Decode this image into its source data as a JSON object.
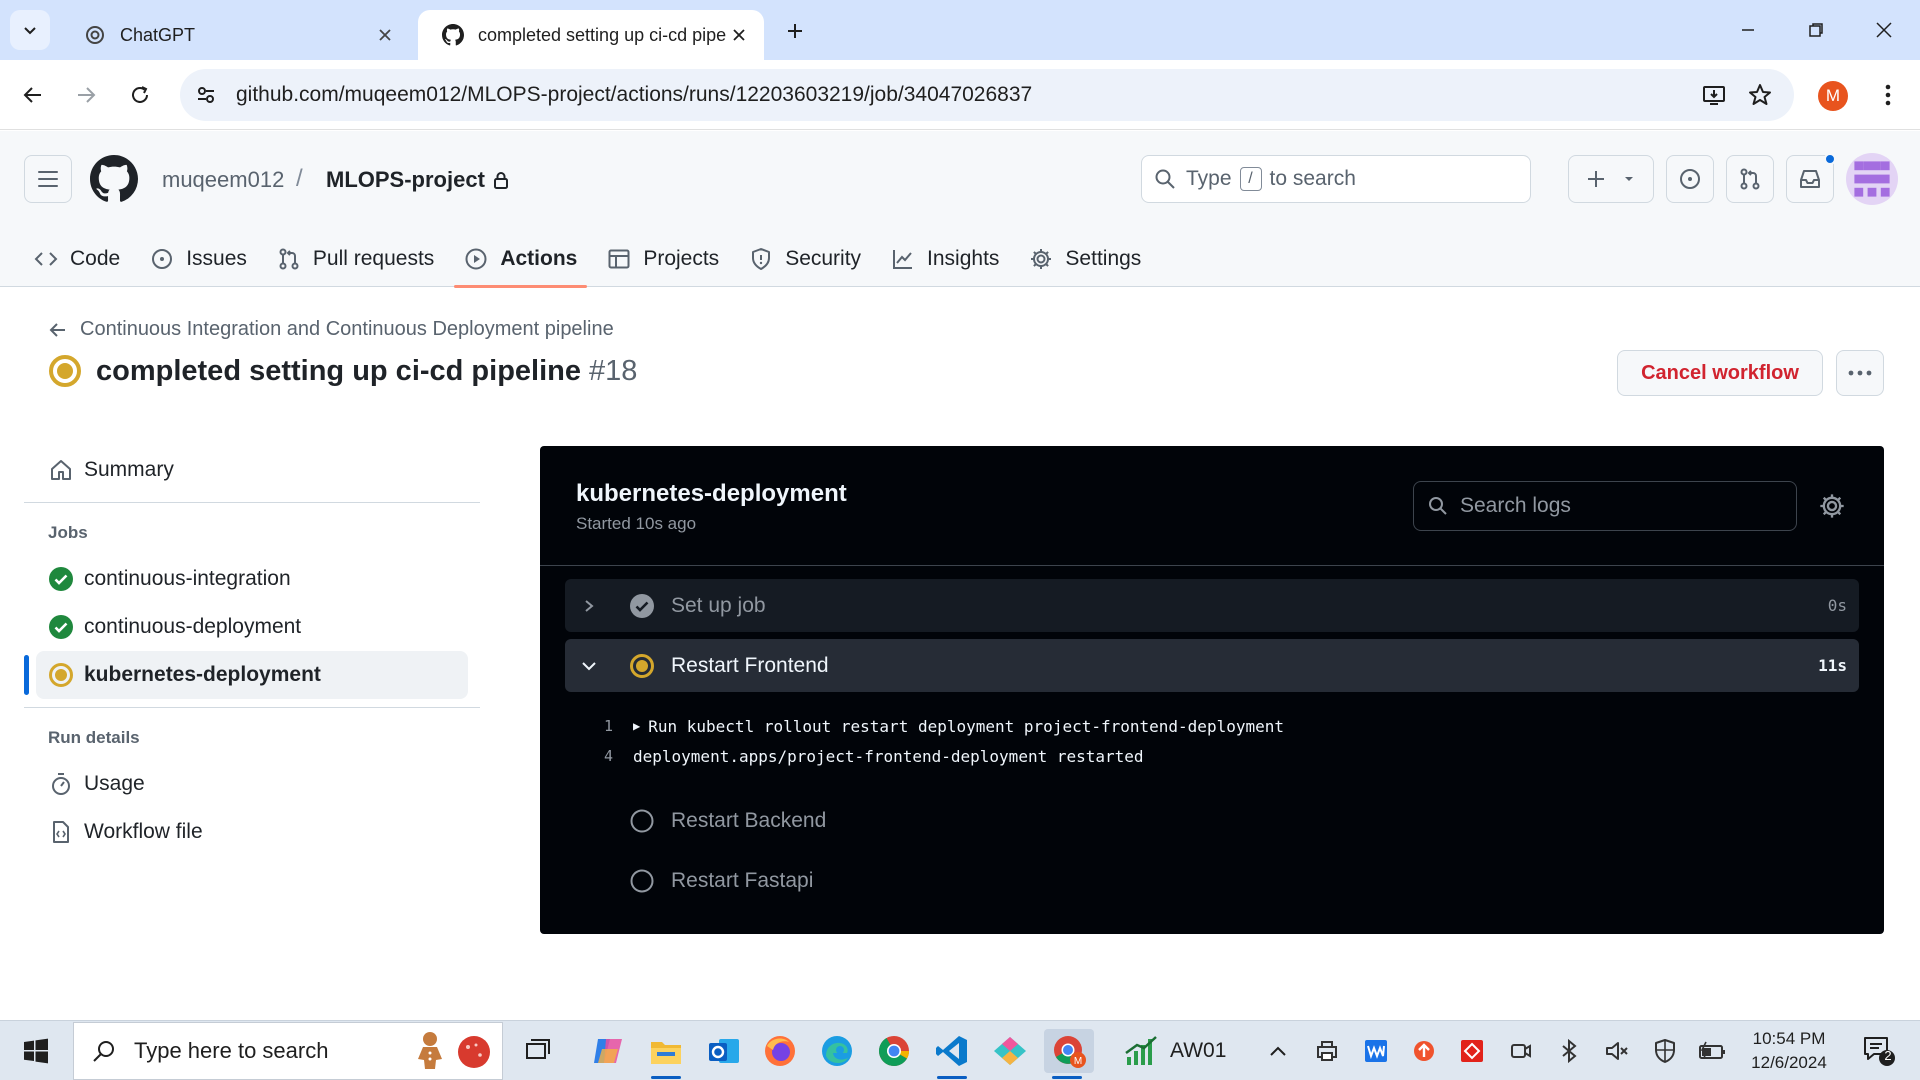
{
  "browser": {
    "tabs": [
      {
        "title": "ChatGPT",
        "icon": "chatgpt-icon",
        "active": false
      },
      {
        "title": "completed setting up ci-cd pipe",
        "icon": "github-icon",
        "active": true
      }
    ],
    "url": "github.com/muqeem012/MLOPS-project/actions/runs/12203603219/job/34047026837",
    "profile_initial": "M"
  },
  "github": {
    "owner": "muqeem012",
    "separator": "/",
    "repo": "MLOPS-project",
    "search": {
      "prefix": "Type",
      "key": "/",
      "suffix": "to search"
    },
    "repo_nav": [
      {
        "label": "Code",
        "icon": "code-icon"
      },
      {
        "label": "Issues",
        "icon": "issue-icon"
      },
      {
        "label": "Pull requests",
        "icon": "pull-request-icon"
      },
      {
        "label": "Actions",
        "icon": "play-icon",
        "active": true
      },
      {
        "label": "Projects",
        "icon": "table-icon"
      },
      {
        "label": "Security",
        "icon": "shield-icon"
      },
      {
        "label": "Insights",
        "icon": "graph-icon"
      },
      {
        "label": "Settings",
        "icon": "gear-icon"
      }
    ],
    "accent": "#fd8c73"
  },
  "run": {
    "workflow": "Continuous Integration and Continuous Deployment pipeline",
    "title": "completed setting up ci-cd pipeline",
    "number": "#18",
    "status": "in_progress",
    "cancel_label": "Cancel workflow"
  },
  "sidebar": {
    "summary": "Summary",
    "jobs_heading": "Jobs",
    "jobs": [
      {
        "name": "continuous-integration",
        "status": "success"
      },
      {
        "name": "continuous-deployment",
        "status": "success"
      },
      {
        "name": "kubernetes-deployment",
        "status": "in_progress",
        "selected": true
      }
    ],
    "details_heading": "Run details",
    "details": [
      {
        "label": "Usage",
        "icon": "stopwatch-icon"
      },
      {
        "label": "Workflow file",
        "icon": "file-code-icon"
      }
    ]
  },
  "job": {
    "name": "kubernetes-deployment",
    "started": "Started 10s ago",
    "search_placeholder": "Search logs",
    "steps": [
      {
        "name": "Set up job",
        "status": "success",
        "duration": "0s",
        "expanded": false
      },
      {
        "name": "Restart Frontend",
        "status": "in_progress",
        "duration": "11s",
        "expanded": true
      },
      {
        "name": "Restart Backend",
        "status": "pending",
        "duration": ""
      },
      {
        "name": "Restart Fastapi",
        "status": "pending",
        "duration": ""
      }
    ],
    "log_lines": [
      {
        "num": "1",
        "text": "Run kubectl rollout restart deployment project-frontend-deployment",
        "collapsible": true
      },
      {
        "num": "4",
        "text": "deployment.apps/project-frontend-deployment restarted",
        "collapsible": false
      }
    ],
    "colors": {
      "success": "#1f883d",
      "in_progress": "#d4a72c",
      "panel_bg": "#010409"
    }
  },
  "taskbar": {
    "search_placeholder": "Type here to search",
    "aw_label": "AW01",
    "time": "10:54 PM",
    "date": "12/6/2024",
    "notification_count": "2",
    "apps": [
      "task-view-icon",
      "copilot-icon",
      "file-explorer-icon",
      "outlook-icon",
      "firefox-icon",
      "edge-icon",
      "chrome-icon",
      "vscode-icon",
      "git-icon",
      "chrome-profile-icon"
    ]
  }
}
